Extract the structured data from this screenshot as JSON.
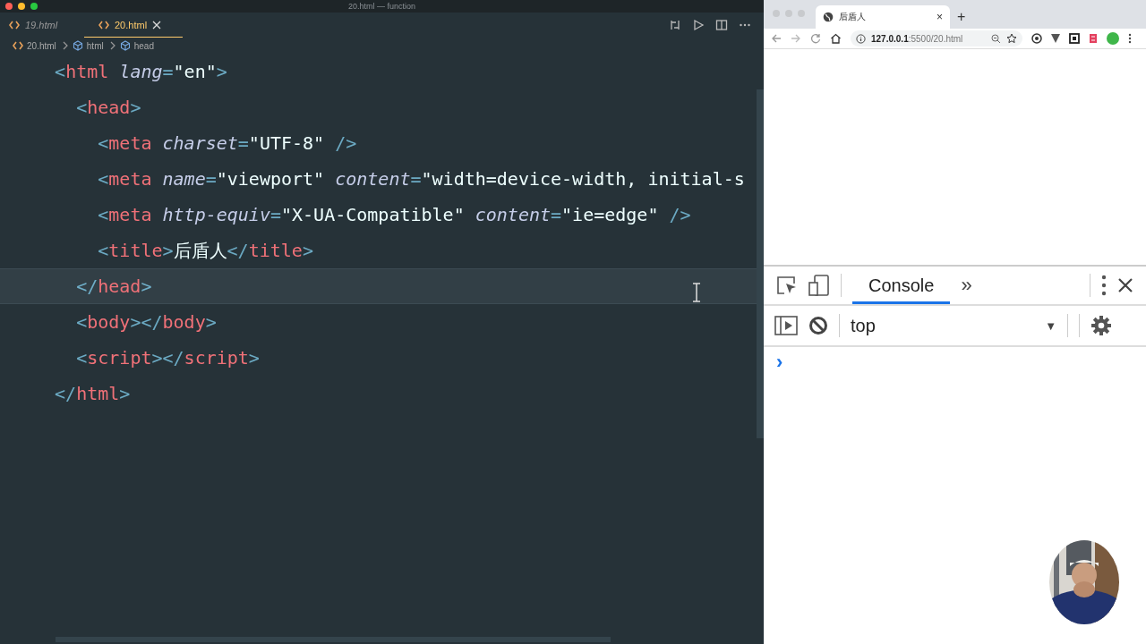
{
  "window": {
    "title": "20.html — function"
  },
  "editor_tabs": [
    {
      "label": "19.html",
      "selected": false,
      "italic": true
    },
    {
      "label": "20.html",
      "selected": true,
      "italic": false
    }
  ],
  "breadcrumbs": [
    "20.html",
    "html",
    "head"
  ],
  "code_lines": [
    {
      "highlighted": false,
      "tokens": [
        {
          "kind": "punct",
          "text": "  <"
        },
        {
          "kind": "tag",
          "text": "html"
        },
        {
          "kind": "attr",
          "text": " lang"
        },
        {
          "kind": "punct",
          "text": "="
        },
        {
          "kind": "str",
          "text": "\"en\""
        },
        {
          "kind": "punct",
          "text": ">"
        }
      ]
    },
    {
      "highlighted": false,
      "tokens": [
        {
          "kind": "punct",
          "text": "    <"
        },
        {
          "kind": "tag",
          "text": "head"
        },
        {
          "kind": "punct",
          "text": ">"
        }
      ]
    },
    {
      "highlighted": false,
      "tokens": [
        {
          "kind": "punct",
          "text": "      <"
        },
        {
          "kind": "tag",
          "text": "meta"
        },
        {
          "kind": "attr",
          "text": " charset"
        },
        {
          "kind": "punct",
          "text": "="
        },
        {
          "kind": "str",
          "text": "\"UTF-8\""
        },
        {
          "kind": "punct",
          "text": " />"
        }
      ]
    },
    {
      "highlighted": false,
      "tokens": [
        {
          "kind": "punct",
          "text": "      <"
        },
        {
          "kind": "tag",
          "text": "meta"
        },
        {
          "kind": "attr",
          "text": " name"
        },
        {
          "kind": "punct",
          "text": "="
        },
        {
          "kind": "str",
          "text": "\"viewport\""
        },
        {
          "kind": "attr",
          "text": " content"
        },
        {
          "kind": "punct",
          "text": "="
        },
        {
          "kind": "str",
          "text": "\"width=device-width, initial-s"
        }
      ]
    },
    {
      "highlighted": false,
      "tokens": [
        {
          "kind": "punct",
          "text": "      <"
        },
        {
          "kind": "tag",
          "text": "meta"
        },
        {
          "kind": "attr",
          "text": " http-equiv"
        },
        {
          "kind": "punct",
          "text": "="
        },
        {
          "kind": "str",
          "text": "\"X-UA-Compatible\""
        },
        {
          "kind": "attr",
          "text": " content"
        },
        {
          "kind": "punct",
          "text": "="
        },
        {
          "kind": "str",
          "text": "\"ie=edge\""
        },
        {
          "kind": "punct",
          "text": " />"
        }
      ]
    },
    {
      "highlighted": false,
      "tokens": [
        {
          "kind": "punct",
          "text": "      <"
        },
        {
          "kind": "tag",
          "text": "title"
        },
        {
          "kind": "punct",
          "text": ">"
        },
        {
          "kind": "text",
          "text": "后盾人"
        },
        {
          "kind": "punct",
          "text": "</"
        },
        {
          "kind": "tag",
          "text": "title"
        },
        {
          "kind": "punct",
          "text": ">"
        }
      ]
    },
    {
      "highlighted": true,
      "tokens": [
        {
          "kind": "punct",
          "text": "    </"
        },
        {
          "kind": "tag",
          "text": "head"
        },
        {
          "kind": "punct",
          "text": ">"
        }
      ]
    },
    {
      "highlighted": false,
      "tokens": [
        {
          "kind": "punct",
          "text": "    <"
        },
        {
          "kind": "tag",
          "text": "body"
        },
        {
          "kind": "punct",
          "text": "></"
        },
        {
          "kind": "tag",
          "text": "body"
        },
        {
          "kind": "punct",
          "text": ">"
        }
      ]
    },
    {
      "highlighted": false,
      "tokens": [
        {
          "kind": "punct",
          "text": "    <"
        },
        {
          "kind": "tag",
          "text": "script"
        },
        {
          "kind": "punct",
          "text": "></"
        },
        {
          "kind": "tag",
          "text": "script"
        },
        {
          "kind": "punct",
          "text": ">"
        }
      ]
    },
    {
      "highlighted": false,
      "tokens": [
        {
          "kind": "punct",
          "text": "  </"
        },
        {
          "kind": "tag",
          "text": "html"
        },
        {
          "kind": "punct",
          "text": ">"
        }
      ]
    }
  ],
  "browser": {
    "tab_title": "后盾人",
    "tab_close": "×",
    "new_tab": "+",
    "url": "**127.0.0.1**:5500/20.html"
  },
  "devtools": {
    "tabs": [
      {
        "label": "Console",
        "selected": true
      }
    ],
    "more_tabs": "»",
    "context": "top",
    "dropdown_arrow": "▼",
    "prompt": "›"
  }
}
